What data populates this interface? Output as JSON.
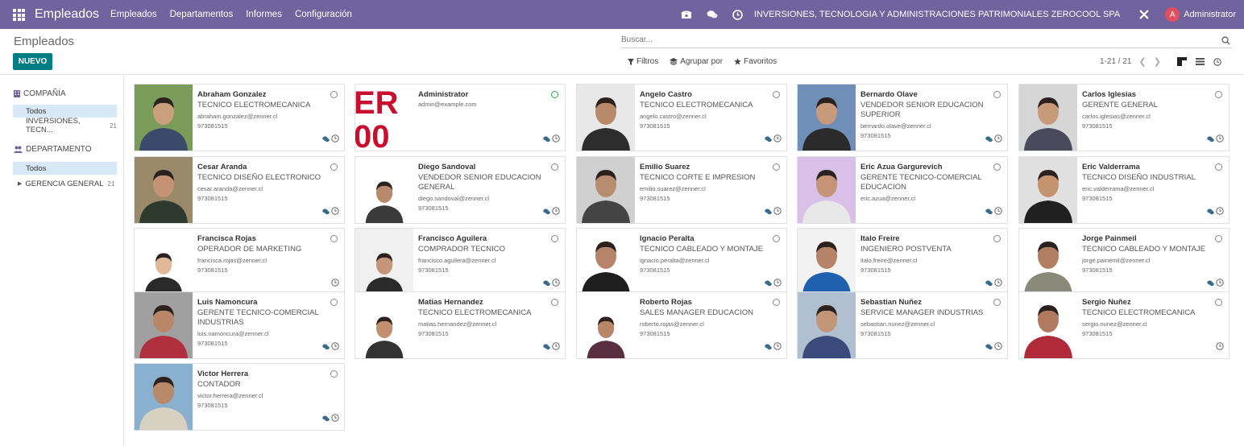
{
  "navbar": {
    "brand": "Empleados",
    "menus": [
      "Empleados",
      "Departamentos",
      "Informes",
      "Configuración"
    ],
    "company": "INVERSIONES, TECNOLOGIA Y ADMINISTRACIONES PATRIMONIALES ZEROCOOL SPA",
    "user_initial": "A",
    "user": "Administrator",
    "bar_color": "#71639e"
  },
  "control": {
    "title": "Empleados",
    "new_label": "NUEVO",
    "search_placeholder": "Buscar...",
    "filters": "Filtros",
    "group_by": "Agrupar por",
    "favorites": "Favoritos",
    "pager": "1-21 / 21"
  },
  "sidebar": {
    "company_head": "COMPAÑÍA",
    "company_all": "Todos",
    "company_item": "INVERSIONES, TECN...",
    "company_count": "21",
    "dept_head": "DEPARTAMENTO",
    "dept_all": "Todos",
    "dept_item": "GERENCIA GENERAL",
    "dept_count": "21"
  },
  "employees": [
    {
      "name": "Abraham Gonzalez",
      "job": "TECNICO ELECTROMECANICA",
      "email": "abraham.gonzalez@zenner.cl",
      "phone": "973081515"
    },
    {
      "name": "Administrator",
      "job": "",
      "email": "admin@example.com",
      "phone": ""
    },
    {
      "name": "Angelo Castro",
      "job": "TECNICO ELECTROMECANICA",
      "email": "angelo.castro@zenner.cl",
      "phone": "973081515"
    },
    {
      "name": "Bernardo Olave",
      "job": "VENDEDOR SENIOR EDUCACION SUPERIOR",
      "email": "bernardo.olave@zenner.cl",
      "phone": "973081515"
    },
    {
      "name": "Carlos Iglesias",
      "job": "GERENTE GENERAL",
      "email": "carlos.iglesias@zenner.cl",
      "phone": "973081515"
    },
    {
      "name": "Cesar Aranda",
      "job": "TECNICO DISEÑO ELECTRONICO",
      "email": "cesar.aranda@zenner.cl",
      "phone": "973081515"
    },
    {
      "name": "Diego Sandoval",
      "job": "VENDEDOR SENIOR EDUCACION GENERAL",
      "email": "diego.sandoval@zenner.cl",
      "phone": "973081515"
    },
    {
      "name": "Emilio Suarez",
      "job": "TECNICO CORTE E IMPRESION",
      "email": "emilio.suarez@zenner.cl",
      "phone": "973081515"
    },
    {
      "name": "Eric Azua Gargurevich",
      "job": "GERENTE TECNICO-COMERCIAL EDUCACION",
      "email": "eric.azua@zenner.cl",
      "phone": ""
    },
    {
      "name": "Eric Valderrama",
      "job": "TECNICO DISEÑO INDUSTRIAL",
      "email": "eric.valderrama@zenner.cl",
      "phone": "973081515"
    },
    {
      "name": "Francisca Rojas",
      "job": "OPERADOR DE MARKETING",
      "email": "francisca.rojas@zenner.cl",
      "phone": "973081515"
    },
    {
      "name": "Francisco Aguilera",
      "job": "COMPRADOR TECNICO",
      "email": "francisco.aguilera@zenner.cl",
      "phone": "973081515"
    },
    {
      "name": "Ignacio Peralta",
      "job": "TECNICO CABLEADO Y MONTAJE",
      "email": "ignacio.peralta@zenner.cl",
      "phone": "973081515"
    },
    {
      "name": "Italo Freire",
      "job": "INGENIERO POSTVENTA",
      "email": "italo.freire@zenner.cl",
      "phone": "973081515"
    },
    {
      "name": "Jorge Painmeil",
      "job": "TECNICO CABLEADO Y MONTAJE",
      "email": "jorge.painemil@zenner.cl",
      "phone": "973081515"
    },
    {
      "name": "Luis Namoncura",
      "job": "GERENTE TECNICO-COMERCIAL INDUSTRIAS",
      "email": "luis.namoncura@zenner.cl",
      "phone": "973081515"
    },
    {
      "name": "Matias Hernandez",
      "job": "TECNICO ELECTROMECANICA",
      "email": "matias.hernandez@zenner.cl",
      "phone": "973081515"
    },
    {
      "name": "Roberto Rojas",
      "job": "SALES MANAGER EDUCACION",
      "email": "roberto.rojas@zenner.cl",
      "phone": "973081515"
    },
    {
      "name": "Sebastian Nuñez",
      "job": "SERVICE MANAGER INDUSTRIAS",
      "email": "sebastian.nunez@zenner.cl",
      "phone": "973081515"
    },
    {
      "name": "Sergio Nuñez",
      "job": "TECNICO ELECTROMECANICA",
      "email": "sergio.nunez@zenner.cl",
      "phone": "973081515"
    },
    {
      "name": "Victor Herrera",
      "job": "CONTADOR",
      "email": "victor.herrera@zenner.cl",
      "phone": "973081515"
    }
  ]
}
